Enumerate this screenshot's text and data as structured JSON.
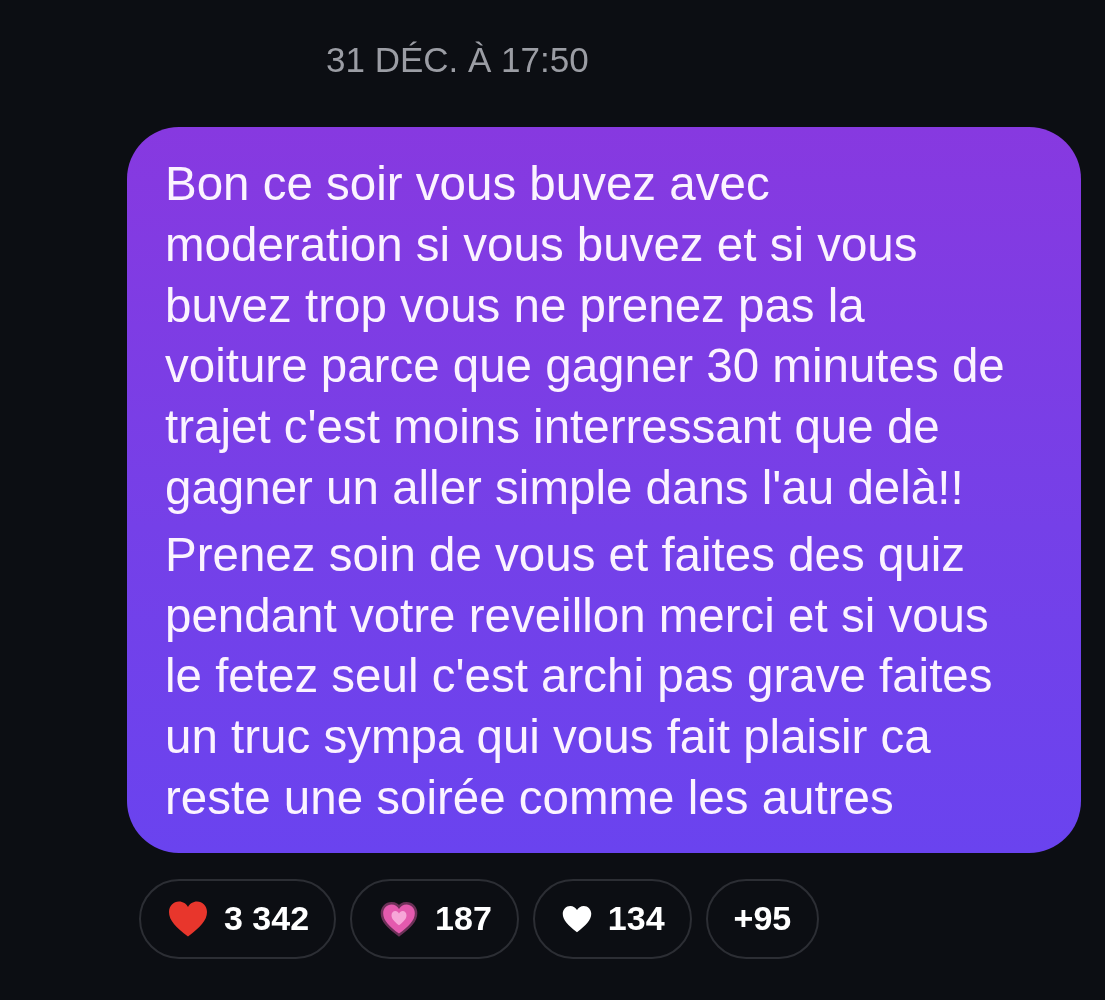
{
  "timestamp": "31 DÉC. À 17:50",
  "message": {
    "paragraphs": [
      [
        "Bon ce soir vous buvez avec",
        "moderation si vous buvez et si vous",
        "buvez trop vous ne prenez pas la",
        "voiture parce que gagner 30 minutes de",
        "trajet c'est moins interressant que de",
        "gagner un aller simple dans l'au delà!!"
      ],
      [
        "Prenez soin de vous et faites des quiz",
        "pendant votre reveillon merci et si vous",
        "le fetez seul c'est archi pas grave faites",
        "un truc sympa qui vous fait plaisir ca",
        "reste une soirée comme les autres"
      ]
    ]
  },
  "reactions": [
    {
      "kind": "heart",
      "color": "#e8362c",
      "count": "3 342"
    },
    {
      "kind": "pulse",
      "color": "#e45aae",
      "count": "187"
    },
    {
      "kind": "heart",
      "color": "#ffffff",
      "count": "134"
    },
    {
      "kind": "more",
      "count": "+95"
    }
  ]
}
